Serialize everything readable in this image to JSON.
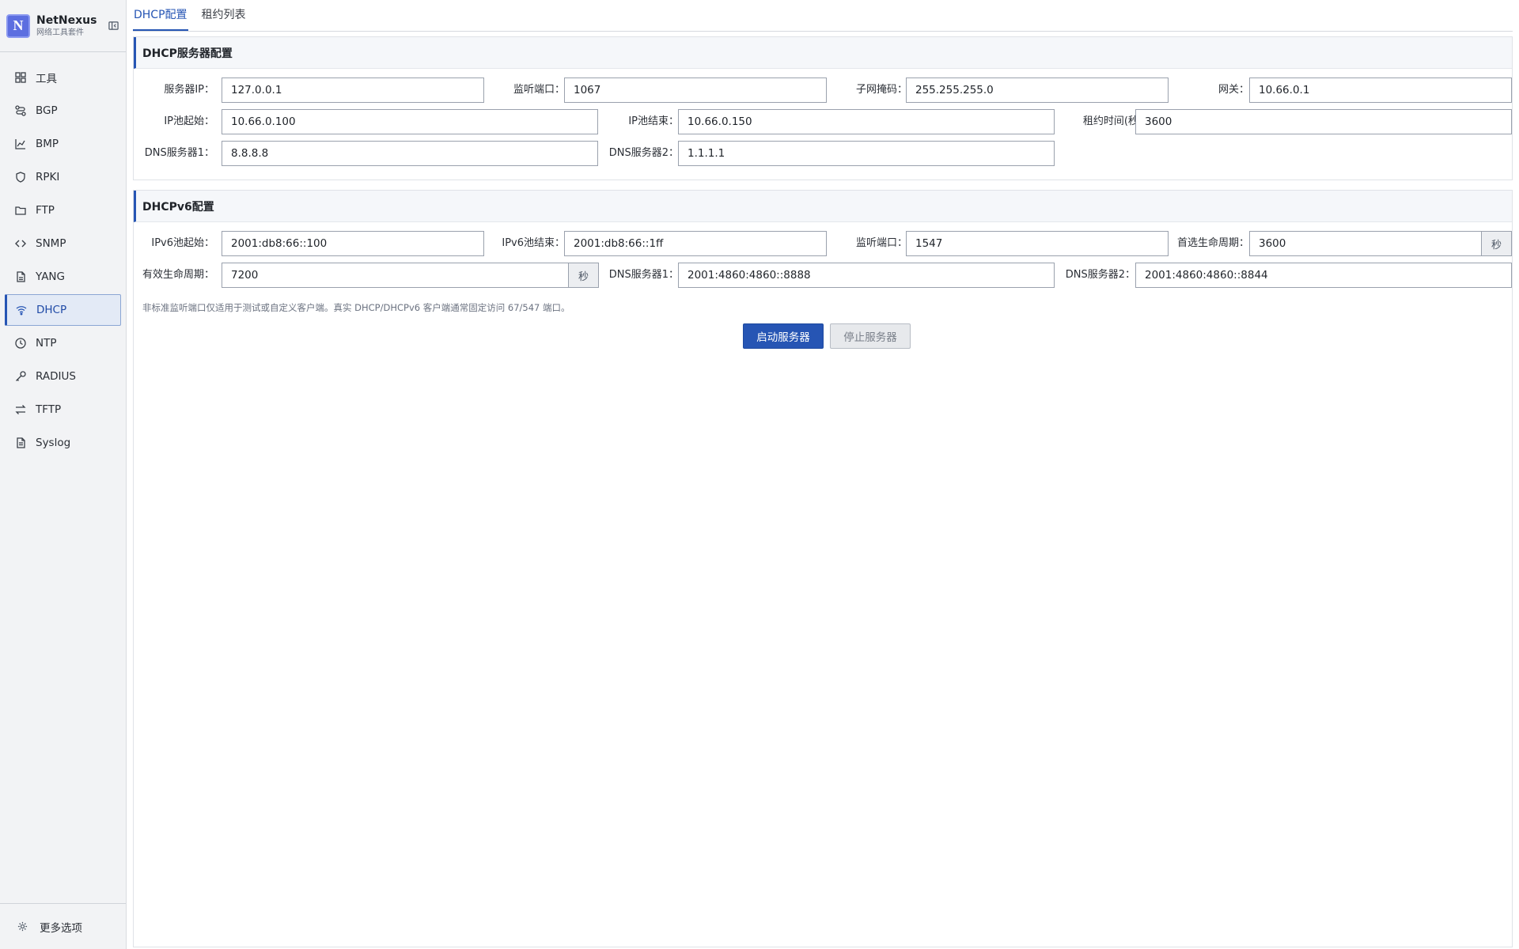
{
  "app": {
    "name": "NetNexus",
    "subtitle": "网络工具套件",
    "logo_letter": "N"
  },
  "sidebar": {
    "items": [
      {
        "label": "工具",
        "icon": "grid-icon"
      },
      {
        "label": "BGP",
        "icon": "route-icon"
      },
      {
        "label": "BMP",
        "icon": "chart-icon"
      },
      {
        "label": "RPKI",
        "icon": "shield-icon"
      },
      {
        "label": "FTP",
        "icon": "folder-icon"
      },
      {
        "label": "SNMP",
        "icon": "code-icon"
      },
      {
        "label": "YANG",
        "icon": "file-icon"
      },
      {
        "label": "DHCP",
        "icon": "wifi-icon",
        "active": true
      },
      {
        "label": "NTP",
        "icon": "clock-icon"
      },
      {
        "label": "RADIUS",
        "icon": "key-icon"
      },
      {
        "label": "TFTP",
        "icon": "transfer-icon"
      },
      {
        "label": "Syslog",
        "icon": "document-icon"
      }
    ],
    "footer_label": "更多选项"
  },
  "tabs": [
    {
      "label": "DHCP配置",
      "active": true
    },
    {
      "label": "租约列表",
      "active": false
    }
  ],
  "dhcp": {
    "title": "DHCP服务器配置",
    "server_ip_label": "服务器IP：",
    "server_ip": "127.0.0.1",
    "listen_port_label": "监听端口：",
    "listen_port": "1067",
    "subnet_label": "子网掩码：",
    "subnet": "255.255.255.0",
    "gateway_label": "网关：",
    "gateway": "10.66.0.1",
    "pool_start_label": "IP池起始：",
    "pool_start": "10.66.0.100",
    "pool_end_label": "IP池结束：",
    "pool_end": "10.66.0.150",
    "lease_label": "租约时间(秒)：",
    "lease": "3600",
    "dns1_label": "DNS服务器1：",
    "dns1": "8.8.8.8",
    "dns2_label": "DNS服务器2：",
    "dns2": "1.1.1.1"
  },
  "dhcpv6": {
    "title": "DHCPv6配置",
    "pool_start_label": "IPv6池起始：",
    "pool_start": "2001:db8:66::100",
    "pool_end_label": "IPv6池结束：",
    "pool_end": "2001:db8:66::1ff",
    "listen_port_label": "监听端口：",
    "listen_port": "1547",
    "preferred_label": "首选生命周期：",
    "preferred": "3600",
    "seconds_suffix": "秒",
    "valid_label": "有效生命周期：",
    "valid": "7200",
    "dns1_label": "DNS服务器1：",
    "dns1": "2001:4860:4860::8888",
    "dns2_label": "DNS服务器2：",
    "dns2": "2001:4860:4860::8844",
    "hint": "非标准监听端口仅适用于测试或自定义客户端。真实 DHCP/DHCPv6 客户端通常固定访问 67/547 端口。"
  },
  "actions": {
    "start_label": "启动服务器",
    "stop_label": "停止服务器"
  }
}
